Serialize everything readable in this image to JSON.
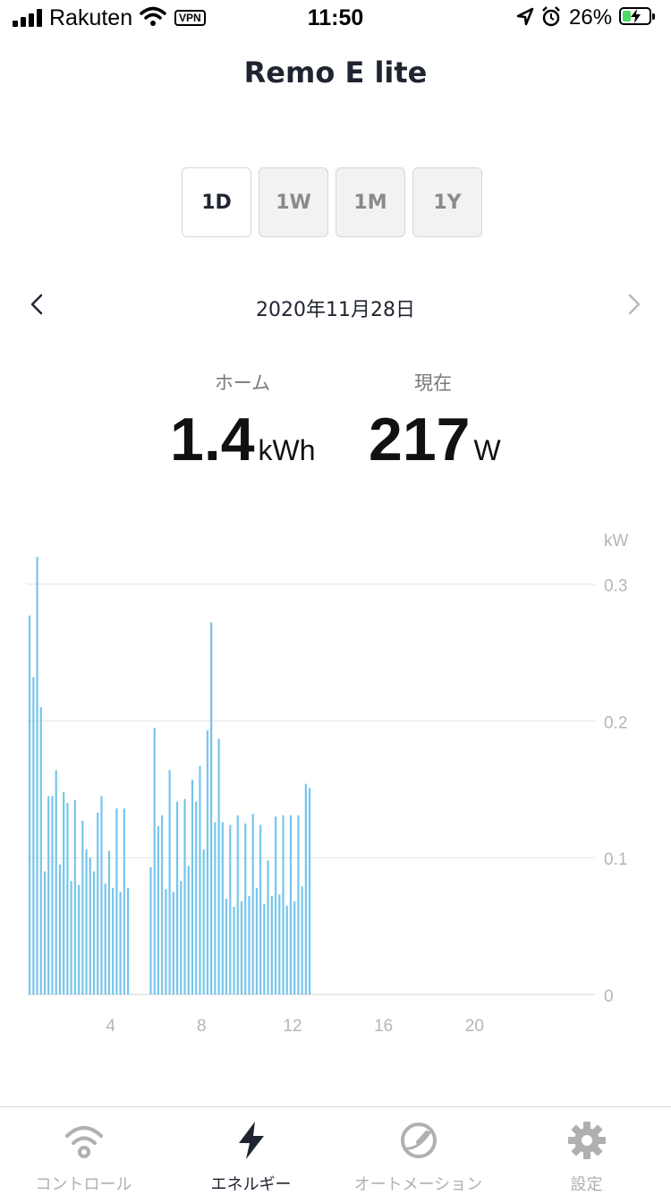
{
  "status_bar": {
    "carrier": "Rakuten",
    "vpn": "VPN",
    "time": "11:50",
    "battery": "26%",
    "icons": [
      "signal-icon",
      "wifi-icon",
      "location-icon",
      "alarm-icon",
      "battery-charging-icon"
    ]
  },
  "header": {
    "title": "Remo E lite"
  },
  "periods": [
    "1D",
    "1W",
    "1M",
    "1Y"
  ],
  "selected_period": "1D",
  "date_nav": {
    "date": "2020年11月28日",
    "prev_icon": "chevron-left-icon",
    "next_icon": "chevron-right-icon"
  },
  "metrics": {
    "home": {
      "label": "ホーム",
      "value": "1.4",
      "unit": "kWh"
    },
    "current": {
      "label": "現在",
      "value": "217",
      "unit": "W"
    }
  },
  "chart_data": {
    "type": "bar",
    "ylabel": "kW",
    "ylim": [
      0,
      0.32
    ],
    "xlim": [
      0,
      24
    ],
    "y_ticks": [
      "0.3",
      "0.2",
      "0.1",
      "0"
    ],
    "y_tick_values": [
      0.3,
      0.2,
      0.1,
      0
    ],
    "x_ticks": [
      "4",
      "8",
      "12",
      "16",
      "20"
    ],
    "x_tick_values": [
      4,
      8,
      12,
      16,
      20
    ],
    "grid": true,
    "color": "#76c5ec",
    "values": [
      0.277,
      0.232,
      0.32,
      0.21,
      0.09,
      0.145,
      0.145,
      0.164,
      0.095,
      0.148,
      0.14,
      0.083,
      0.142,
      0.08,
      0.127,
      0.106,
      0.1,
      0.09,
      0.133,
      0.145,
      0.081,
      0.105,
      0.078,
      0.136,
      0.075,
      0.136,
      0.078,
      null,
      null,
      null,
      null,
      null,
      0.093,
      0.195,
      0.123,
      0.131,
      0.077,
      0.164,
      0.075,
      0.141,
      0.083,
      0.143,
      0.094,
      0.157,
      0.141,
      0.167,
      0.106,
      0.193,
      0.272,
      0.126,
      0.187,
      0.126,
      0.07,
      0.124,
      0.064,
      0.131,
      0.068,
      0.125,
      0.072,
      0.132,
      0.078,
      0.124,
      0.066,
      0.098,
      0.072,
      0.13,
      0.073,
      0.131,
      0.065,
      0.131,
      0.068,
      0.131,
      0.079,
      0.154,
      0.151
    ]
  },
  "tab_bar": {
    "items": [
      {
        "label": "コントロール",
        "icon": "wifi-icon"
      },
      {
        "label": "エネルギー",
        "icon": "lightning-icon"
      },
      {
        "label": "オートメーション",
        "icon": "speedometer-icon"
      },
      {
        "label": "設定",
        "icon": "gear-icon"
      }
    ],
    "active": "エネルギー"
  }
}
